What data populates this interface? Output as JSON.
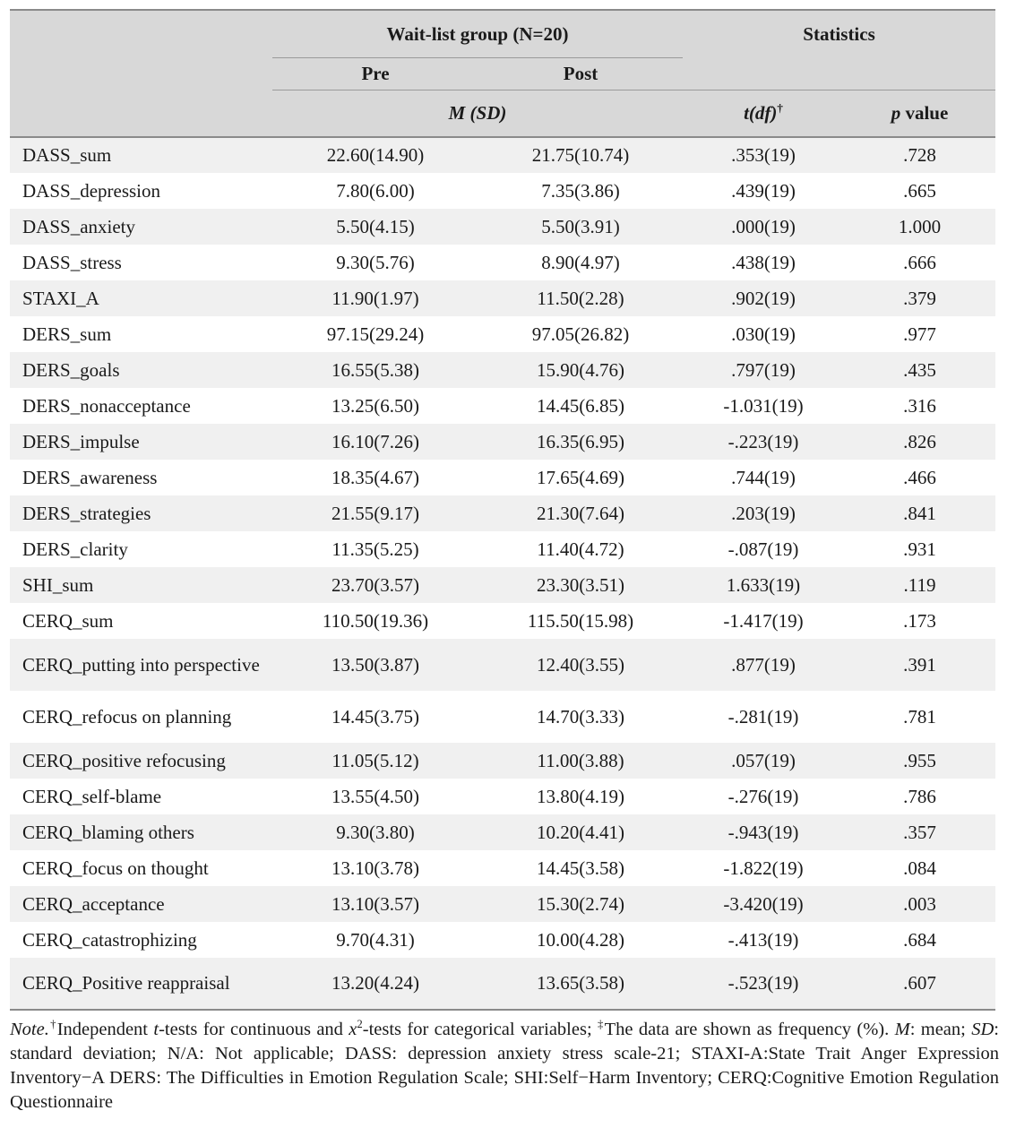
{
  "header": {
    "group_title": "Wait-list group  (N=20)",
    "statistics_title": "Statistics",
    "pre_label": "Pre",
    "post_label": "Post",
    "msd_label_m": "M",
    "msd_label_sd": "(SD)",
    "t_label_main": "t(df)",
    "t_label_dagger": "†",
    "p_label_italic": "p",
    "p_label_rest": " value"
  },
  "columns": [
    "",
    "Pre",
    "Post",
    "t(df)†",
    "p value"
  ],
  "rows": [
    {
      "label": "DASS_sum",
      "pre": "22.60(14.90)",
      "post": "21.75(10.74)",
      "t": ".353(19)",
      "p": ".728"
    },
    {
      "label": "DASS_depression",
      "pre": "7.80(6.00)",
      "post": "7.35(3.86)",
      "t": ".439(19)",
      "p": ".665"
    },
    {
      "label": "DASS_anxiety",
      "pre": "5.50(4.15)",
      "post": "5.50(3.91)",
      "t": ".000(19)",
      "p": "1.000"
    },
    {
      "label": "DASS_stress",
      "pre": "9.30(5.76)",
      "post": "8.90(4.97)",
      "t": ".438(19)",
      "p": ".666"
    },
    {
      "label": "STAXI_A",
      "pre": "11.90(1.97)",
      "post": "11.50(2.28)",
      "t": ".902(19)",
      "p": ".379"
    },
    {
      "label": "DERS_sum",
      "pre": "97.15(29.24)",
      "post": "97.05(26.82)",
      "t": ".030(19)",
      "p": ".977"
    },
    {
      "label": "DERS_goals",
      "pre": "16.55(5.38)",
      "post": "15.90(4.76)",
      "t": ".797(19)",
      "p": ".435"
    },
    {
      "label": "DERS_nonacceptance",
      "pre": "13.25(6.50)",
      "post": "14.45(6.85)",
      "t": "-1.031(19)",
      "p": ".316"
    },
    {
      "label": "DERS_impulse",
      "pre": "16.10(7.26)",
      "post": "16.35(6.95)",
      "t": "-.223(19)",
      "p": ".826"
    },
    {
      "label": "DERS_awareness",
      "pre": "18.35(4.67)",
      "post": "17.65(4.69)",
      "t": ".744(19)",
      "p": ".466"
    },
    {
      "label": "DERS_strategies",
      "pre": "21.55(9.17)",
      "post": "21.30(7.64)",
      "t": ".203(19)",
      "p": ".841"
    },
    {
      "label": "DERS_clarity",
      "pre": "11.35(5.25)",
      "post": "11.40(4.72)",
      "t": "-.087(19)",
      "p": ".931"
    },
    {
      "label": "SHI_sum",
      "pre": "23.70(3.57)",
      "post": "23.30(3.51)",
      "t": "1.633(19)",
      "p": ".119"
    },
    {
      "label": "CERQ_sum",
      "pre": "110.50(19.36)",
      "post": "115.50(15.98)",
      "t": "-1.417(19)",
      "p": ".173"
    },
    {
      "label": "CERQ_putting  into perspective",
      "pre": "13.50(3.87)",
      "post": "12.40(3.55)",
      "t": ".877(19)",
      "p": ".391"
    },
    {
      "label": "CERQ_refocus  on planning",
      "pre": "14.45(3.75)",
      "post": "14.70(3.33)",
      "t": "-.281(19)",
      "p": ".781"
    },
    {
      "label": "CERQ_positive  refocusing",
      "pre": "11.05(5.12)",
      "post": "11.00(3.88)",
      "t": ".057(19)",
      "p": ".955"
    },
    {
      "label": "CERQ_self-blame",
      "pre": "13.55(4.50)",
      "post": "13.80(4.19)",
      "t": "-.276(19)",
      "p": ".786"
    },
    {
      "label": "CERQ_blaming  others",
      "pre": "9.30(3.80)",
      "post": "10.20(4.41)",
      "t": "-.943(19)",
      "p": ".357"
    },
    {
      "label": "CERQ_focus  on  thought",
      "pre": "13.10(3.78)",
      "post": "14.45(3.58)",
      "t": "-1.822(19)",
      "p": ".084"
    },
    {
      "label": "CERQ_acceptance",
      "pre": "13.10(3.57)",
      "post": "15.30(2.74)",
      "t": "-3.420(19)",
      "p": ".003"
    },
    {
      "label": "CERQ_catastrophizing",
      "pre": "9.70(4.31)",
      "post": "10.00(4.28)",
      "t": "-.413(19)",
      "p": ".684"
    },
    {
      "label": "CERQ_Positive  reappraisal",
      "pre": "13.20(4.24)",
      "post": "13.65(3.58)",
      "t": "-.523(19)",
      "p": ".607"
    }
  ],
  "note": {
    "word_note": "Note.",
    "dagger1": "†",
    "seg1": "Independent ",
    "italic_t": "t",
    "seg2": "-tests for continuous and ",
    "italic_x": "x",
    "sup2": "2",
    "seg3": "-tests for categorical variables; ",
    "dagger2": "‡",
    "seg4": "The data are shown as frequency (%). ",
    "italic_M": "M",
    "seg5": ": mean; ",
    "italic_SD": "SD",
    "seg6": ": standard deviation; N/A: Not applicable; DASS: depression anxiety stress scale-21; STAXI-A:State Trait Anger Expression Inventory−A  DERS: The Difficulties in Emotion Regulation Scale; SHI:Self−Harm Inventory; CERQ:Cognitive Emotion Regulation Questionnaire"
  },
  "colors": {
    "header_bg": "#d8d8d8",
    "stripe_bg": "#f0f0f0",
    "row_bg": "#ffffff",
    "rule": "#8a8a8a",
    "thin_rule": "#9a9a9a",
    "text": "#1a1a1a"
  }
}
